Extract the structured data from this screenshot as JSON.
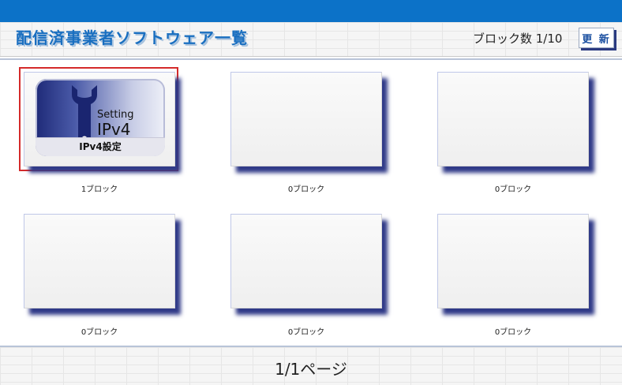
{
  "header": {
    "title": "配信済事業者ソフトウェア一覧",
    "block_count": "ブロック数 1/10",
    "refresh_label": "更 新"
  },
  "tiles": [
    {
      "label": "1ブロック",
      "icon_setting": "Setting",
      "icon_title": "IPv4",
      "icon_subtitle": "IPv4設定",
      "selected": true
    },
    {
      "label": "0ブロック"
    },
    {
      "label": "0ブロック"
    },
    {
      "label": "0ブロック"
    },
    {
      "label": "0ブロック"
    },
    {
      "label": "0ブロック"
    }
  ],
  "footer": {
    "pager": "1/1ページ"
  },
  "colors": {
    "topbar": "#0c72c8",
    "title": "#1a6fc0",
    "tile_shadow": "#303a88",
    "selection": "#d42a2a"
  }
}
